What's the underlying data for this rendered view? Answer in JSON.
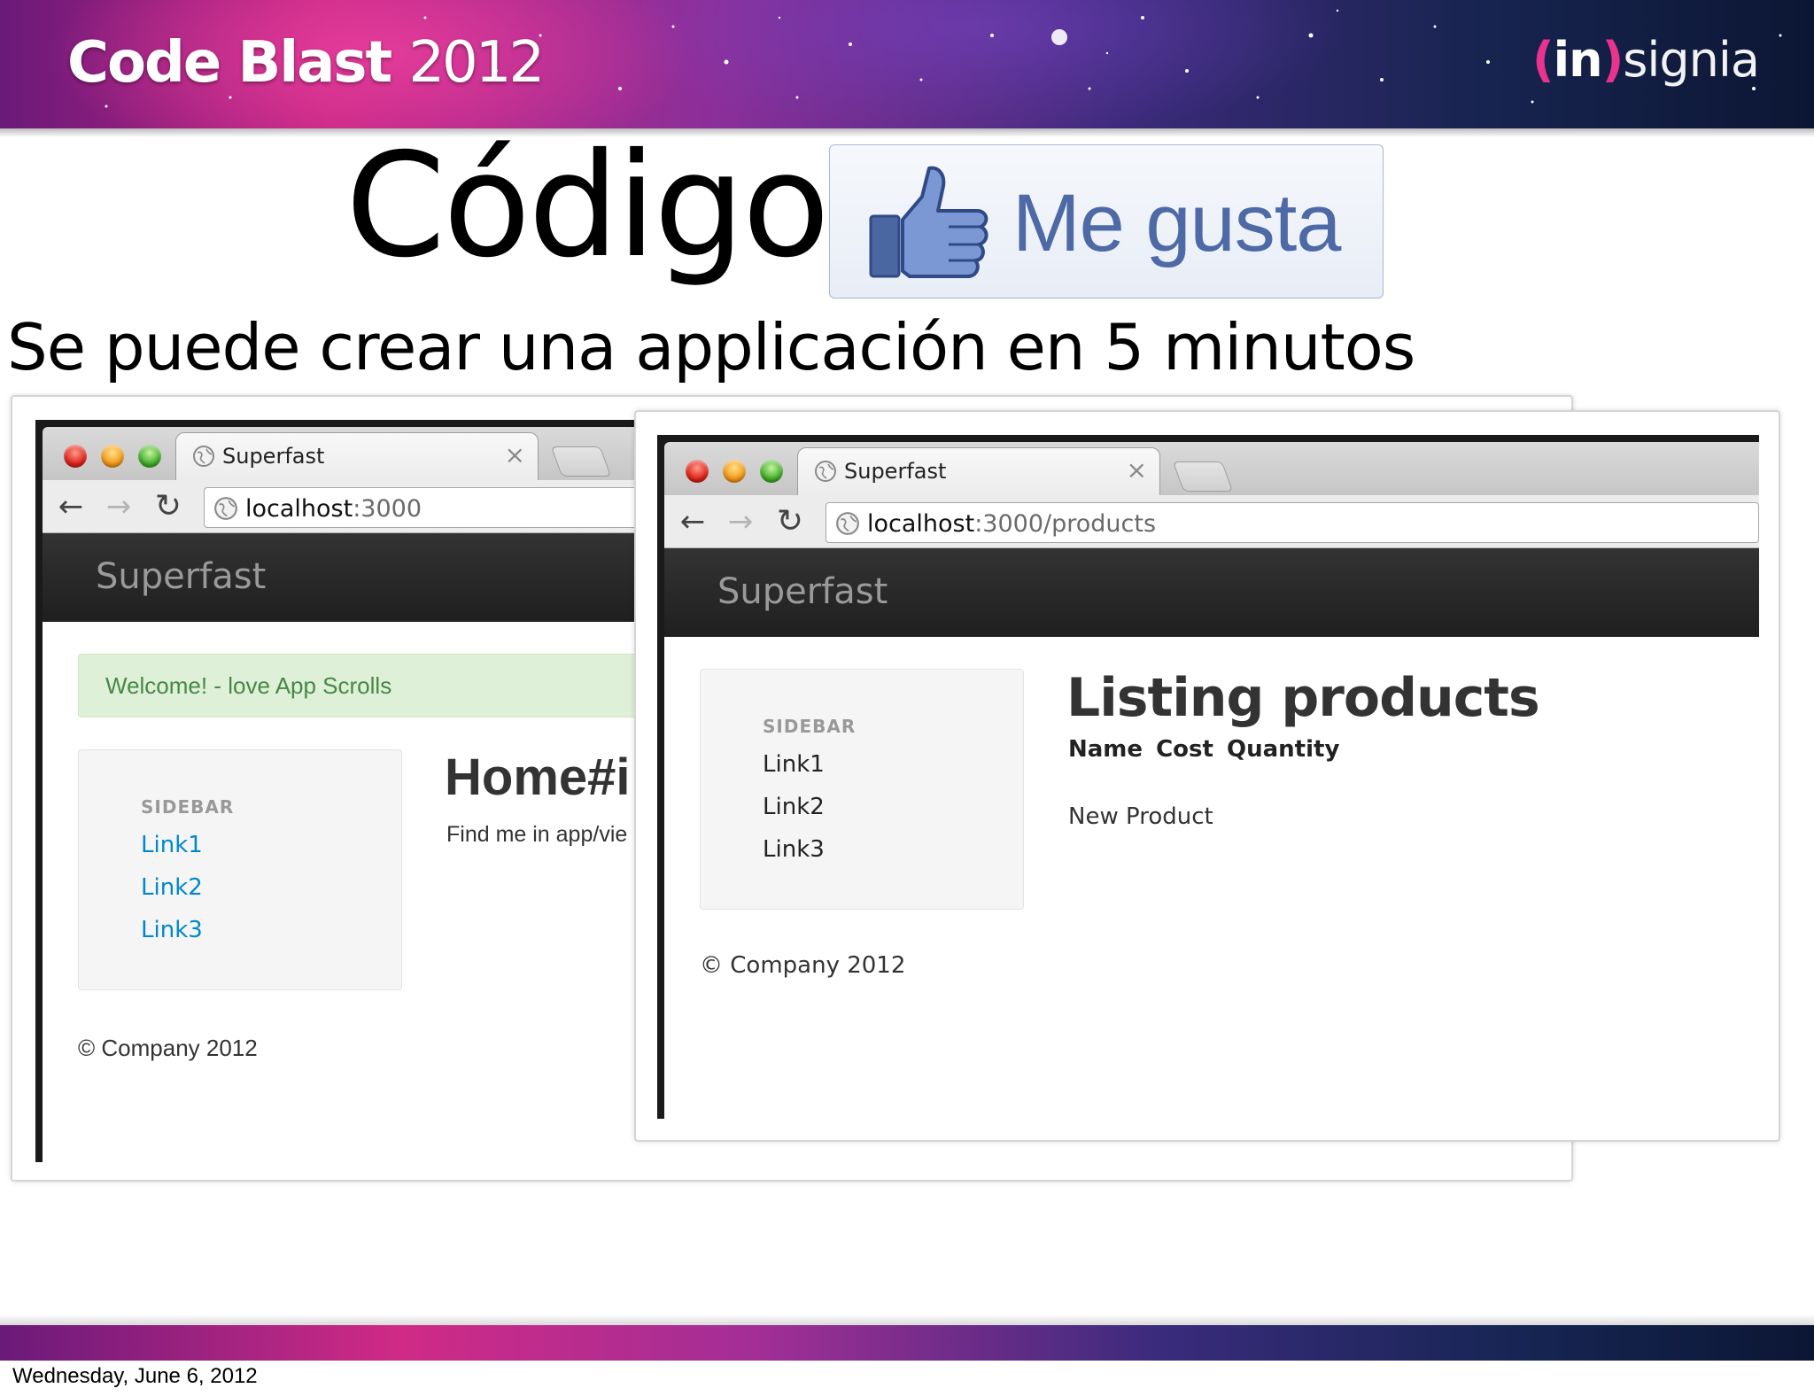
{
  "slide": {
    "brand_name": "Code Blast",
    "brand_year": "2012",
    "sponsor_paren_open": "(",
    "sponsor_in": "in",
    "sponsor_paren_close": ")",
    "sponsor_rest": "signia",
    "title": "Código!",
    "like_label": "Me gusta",
    "subtitle": "Se puede crear una applicación en 5 minutos",
    "date": "Wednesday, June 6, 2012"
  },
  "browser_home": {
    "tab_title": "Superfast",
    "tab_close": "×",
    "url_host": "localhost",
    "url_rest": ":3000",
    "brand": "Superfast",
    "alert": "Welcome! - love App Scrolls",
    "sidebar": {
      "header": "SIDEBAR",
      "links": [
        "Link1",
        "Link2",
        "Link3"
      ]
    },
    "heading": "Home#i",
    "subtext": "Find me in app/vie",
    "footer": "© Company 2012"
  },
  "browser_products": {
    "tab_title": "Superfast",
    "tab_close": "×",
    "url_host": "localhost",
    "url_rest": ":3000/products",
    "brand": "Superfast",
    "sidebar": {
      "header": "SIDEBAR",
      "links": [
        "Link1",
        "Link2",
        "Link3"
      ]
    },
    "heading": "Listing products",
    "table_headers": [
      "Name",
      "Cost",
      "Quantity"
    ],
    "new_link": "New Product",
    "footer": "© Company 2012"
  },
  "icons": {
    "back": "←",
    "forward": "→",
    "reload": "↻"
  },
  "colors": {
    "like_text": "#4d6aa6",
    "alert_bg": "#dff0d8",
    "alert_text": "#468847",
    "link": "#0088cc",
    "navbar": "#222222"
  }
}
